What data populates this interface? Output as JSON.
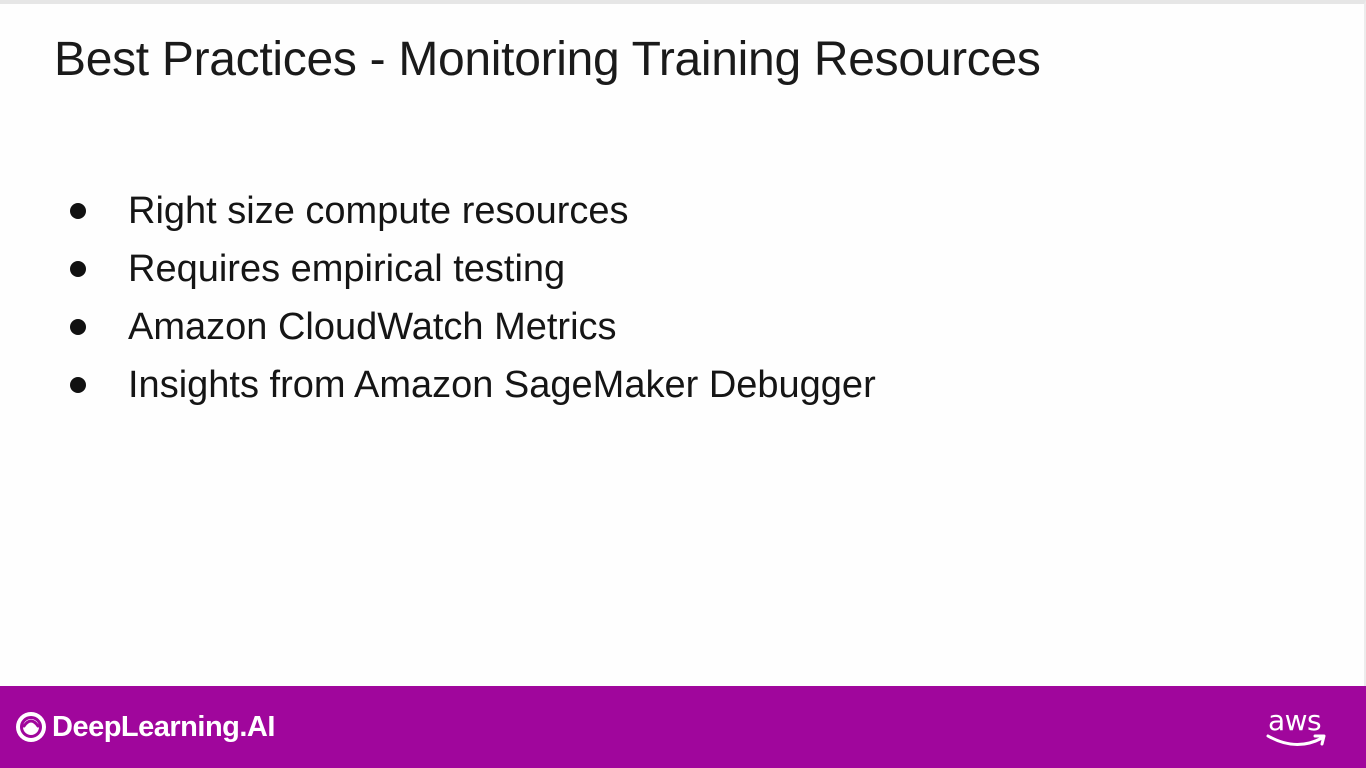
{
  "slide": {
    "title": "Best Practices - Monitoring Training Resources",
    "bullets": [
      "Right size compute resources",
      "Requires empirical testing",
      "Amazon CloudWatch Metrics",
      "Insights from Amazon SageMaker Debugger"
    ]
  },
  "footer": {
    "brand": "DeepLearning.AI",
    "partner": "aws",
    "brand_icon": "deeplearning-ai-logo-icon",
    "partner_icon": "aws-smile-icon",
    "colors": {
      "footer_bg": "#a0069c",
      "text": "#ffffff"
    }
  }
}
